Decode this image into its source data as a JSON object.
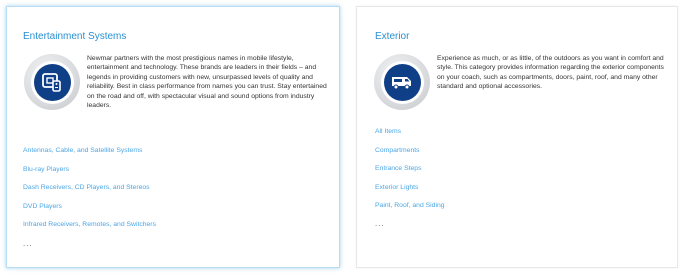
{
  "cards": [
    {
      "title": "Entertainment Systems",
      "icon": "entertainment-remote-icon",
      "description": "Newmar partners with the most prestigious names in mobile lifestyle, entertainment and technology. These brands are leaders in their fields – and legends in providing customers with new, unsurpassed levels of quality and reliability. Best in class performance from names you can trust. Stay entertained on the road and off, with spectacular visual and sound options from industry leaders.",
      "links": [
        "Antennas, Cable, and Satellite Systems",
        "Blu-ray Players",
        "Dash Receivers, CD Players, and Stereos",
        "DVD Players",
        "Infrared Receivers, Remotes, and Switchers"
      ],
      "more": "..."
    },
    {
      "title": "Exterior",
      "icon": "coach-exterior-icon",
      "description": "Experience as much, or as little, of the outdoors as you want in comfort and style. This category provides information regarding the exterior components on your coach, such as compartments, doors, paint, roof, and many other standard and optional accessories.",
      "links": [
        "All Items",
        "Compartments",
        "Entrance Steps",
        "Exterior Lights",
        "Paint, Roof, and Siding"
      ],
      "more": "..."
    }
  ],
  "colors": {
    "title": "#2a8fd2",
    "link": "#4ba6e6",
    "icon_core": "#0f3f86",
    "active_border": "#b9ddf2"
  }
}
